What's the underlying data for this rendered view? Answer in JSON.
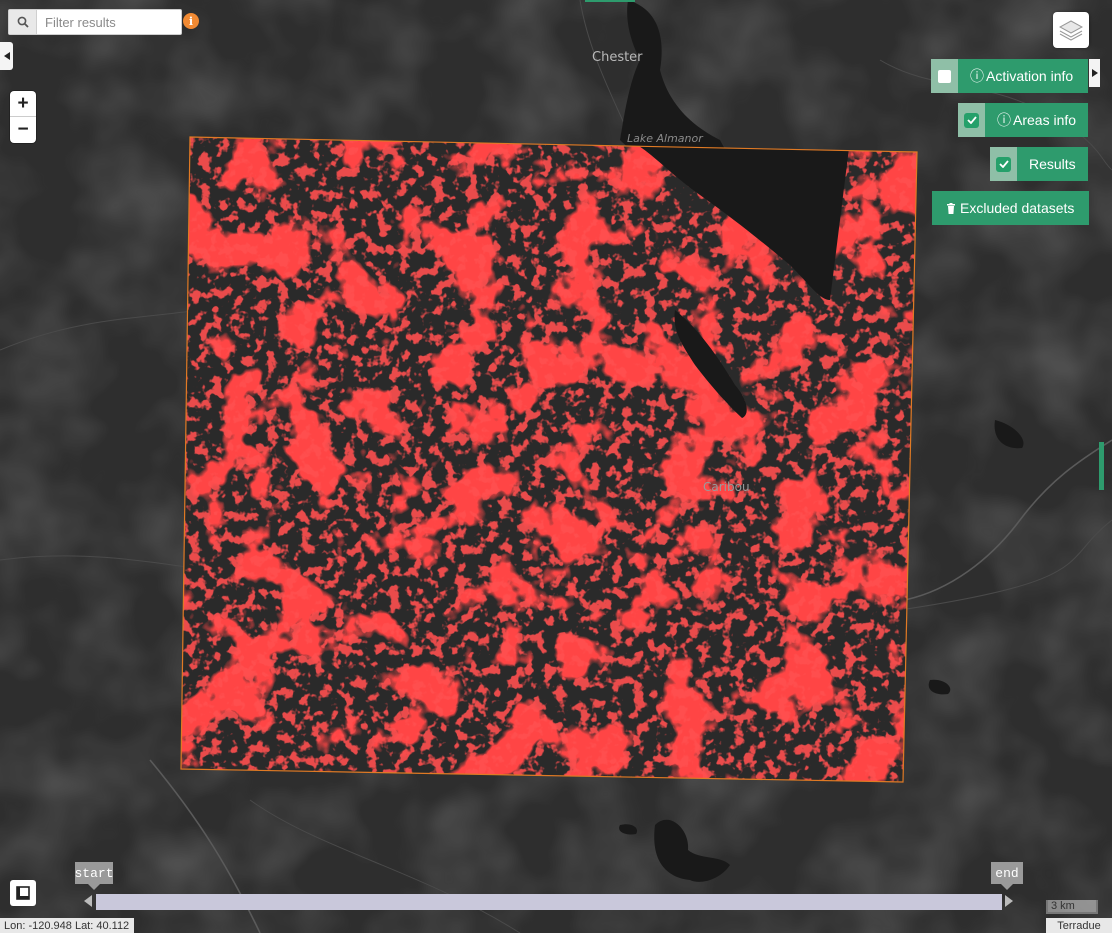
{
  "colors": {
    "map_background": "#2e2e2e",
    "water": "#191919",
    "result_pixels": "#ff1a1a",
    "aoi_outline": "#e07a24",
    "accent_green": "#2e9b6d",
    "info_orange": "#f18a33"
  },
  "map": {
    "places": [
      "Chester",
      "Lake Almanor",
      "Caribou"
    ]
  },
  "search": {
    "placeholder": "Filter results",
    "icon": "search-icon"
  },
  "zoom": {
    "in": "+",
    "out": "−"
  },
  "controls": {
    "activation_info": {
      "label": "Activation info",
      "checked": false,
      "icon": "info-circle-icon"
    },
    "areas_info": {
      "label": "Areas info",
      "checked": true,
      "icon": "info-circle-icon"
    },
    "results": {
      "label": "Results",
      "checked": true
    },
    "excluded_datasets": {
      "label": "Excluded datasets",
      "icon": "trash-icon"
    }
  },
  "timeline": {
    "start_label": "start",
    "end_label": "end"
  },
  "status": {
    "coordinates": "Lon: -120.948 Lat: 40.112",
    "scale": "3 km",
    "attribution": "Terradue"
  }
}
